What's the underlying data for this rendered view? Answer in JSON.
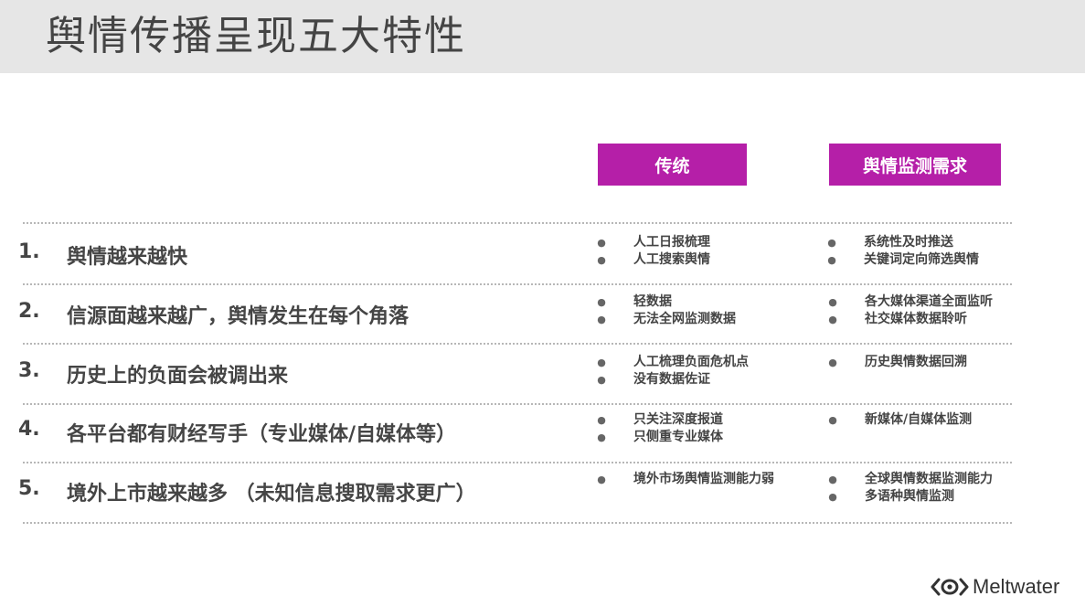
{
  "slide_title": "舆情传播呈现五大特性",
  "headers": {
    "traditional": "传统",
    "demand": "舆情监测需求"
  },
  "rows": [
    {
      "num": "1.",
      "label": "舆情越来越快",
      "traditional": [
        "人工日报梳理",
        "人工搜索舆情"
      ],
      "demand": [
        "系统性及时推送",
        "关键词定向筛选舆情"
      ]
    },
    {
      "num": "2.",
      "label": "信源面越来越广，舆情发生在每个角落",
      "traditional": [
        "轻数据",
        "无法全网监测数据"
      ],
      "demand": [
        "各大媒体渠道全面监听",
        "社交媒体数据聆听"
      ]
    },
    {
      "num": "3.",
      "label": "历史上的负面会被调出来",
      "traditional": [
        "人工梳理负面危机点",
        "没有数据佐证"
      ],
      "demand": [
        "历史舆情数据回溯"
      ]
    },
    {
      "num": "4.",
      "label": "各平台都有财经写手（专业媒体/自媒体等）",
      "traditional": [
        "只关注深度报道",
        "只侧重专业媒体"
      ],
      "demand": [
        "新媒体/自媒体监测"
      ]
    },
    {
      "num": "5.",
      "label": "境外上市越来越多 （未知信息搜取需求更广）",
      "traditional": [
        "境外市场舆情监测能力弱"
      ],
      "demand": [
        "全球舆情数据监测能力",
        "多语种舆情监测"
      ]
    }
  ],
  "bullet_glyph": "●",
  "brand": {
    "name": "Meltwater",
    "icon": "meltwater-logo-icon",
    "accent": "#b51fa8"
  }
}
